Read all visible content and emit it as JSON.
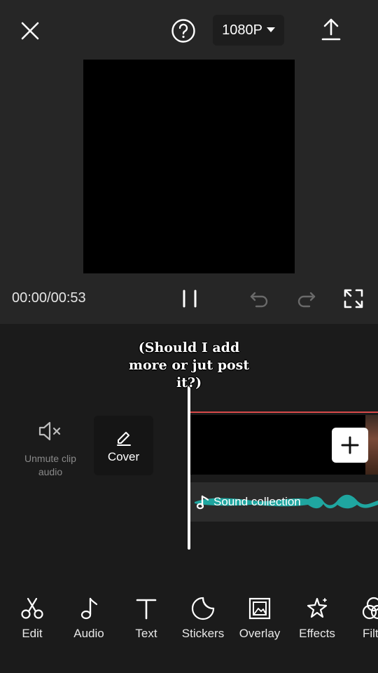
{
  "header": {
    "resolution_label": "1080P"
  },
  "player": {
    "timecode": "00:00/00:53"
  },
  "timeline": {
    "caption_text": "(Should I add more or jut post it?)",
    "mute_label": "Unmute clip audio",
    "cover_label": "Cover",
    "sound_label": "Sound collection",
    "colors": {
      "audio_wave": "#1fa6a0",
      "selection_line": "#d84a4a"
    }
  },
  "toolbar": {
    "items": [
      {
        "label": "Edit",
        "icon": "scissors-icon"
      },
      {
        "label": "Audio",
        "icon": "music-note-icon"
      },
      {
        "label": "Text",
        "icon": "text-icon"
      },
      {
        "label": "Stickers",
        "icon": "sticker-icon"
      },
      {
        "label": "Overlay",
        "icon": "overlay-icon"
      },
      {
        "label": "Effects",
        "icon": "sparkle-icon"
      },
      {
        "label": "Filte",
        "icon": "filters-icon"
      }
    ]
  }
}
